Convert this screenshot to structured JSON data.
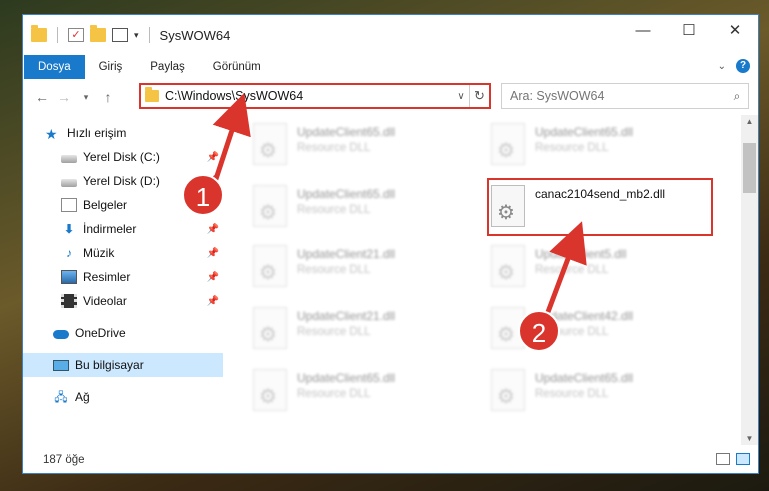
{
  "window": {
    "title": "SysWOW64",
    "controls": {
      "minimize": "—",
      "maximize": "☐",
      "close": "✕"
    }
  },
  "ribbon": {
    "tabs": [
      {
        "label": "Dosya",
        "active": true
      },
      {
        "label": "Giriş"
      },
      {
        "label": "Paylaş"
      },
      {
        "label": "Görünüm"
      }
    ],
    "help": "?"
  },
  "address": {
    "path": "C:\\Windows\\SysWOW64",
    "search_placeholder": "Ara: SysWOW64"
  },
  "nav": {
    "quick_access": "Hızlı erişim",
    "items": [
      {
        "label": "Yerel Disk (C:)",
        "icon": "disk-icon",
        "pinned": true
      },
      {
        "label": "Yerel Disk (D:)",
        "icon": "disk-icon",
        "pinned": true
      },
      {
        "label": "Belgeler",
        "icon": "documents-icon",
        "pinned": true
      },
      {
        "label": "İndirmeler",
        "icon": "download-icon",
        "pinned": true
      },
      {
        "label": "Müzik",
        "icon": "music-icon",
        "pinned": true
      },
      {
        "label": "Resimler",
        "icon": "pictures-icon",
        "pinned": true
      },
      {
        "label": "Videolar",
        "icon": "videos-icon",
        "pinned": true
      }
    ],
    "onedrive": "OneDrive",
    "this_pc": "Bu bilgisayar",
    "network": "Ağ"
  },
  "files": [
    {
      "name": "UpdateClient65.dll",
      "desc": "Resource DLL"
    },
    {
      "name": "UpdateClient65.dll",
      "desc": "Resource DLL"
    },
    {
      "name": "UpdateClient65.dll",
      "desc": "Resource DLL"
    },
    {
      "name": "canac2104send_mb2.dll",
      "desc": ""
    },
    {
      "name": "UpdateClient21.dll",
      "desc": "Resource DLL"
    },
    {
      "name": "UpdateClient5.dll",
      "desc": "Resource DLL"
    },
    {
      "name": "UpdateClient21.dll",
      "desc": "Resource DLL"
    },
    {
      "name": "UpdateClient42.dll",
      "desc": "Resource DLL"
    },
    {
      "name": "UpdateClient65.dll",
      "desc": "Resource DLL"
    },
    {
      "name": "UpdateClient65.dll",
      "desc": "Resource DLL"
    }
  ],
  "status": {
    "count": "187 öğe"
  },
  "annotations": {
    "step1": "1",
    "step2": "2",
    "accent": "#d9352d"
  }
}
